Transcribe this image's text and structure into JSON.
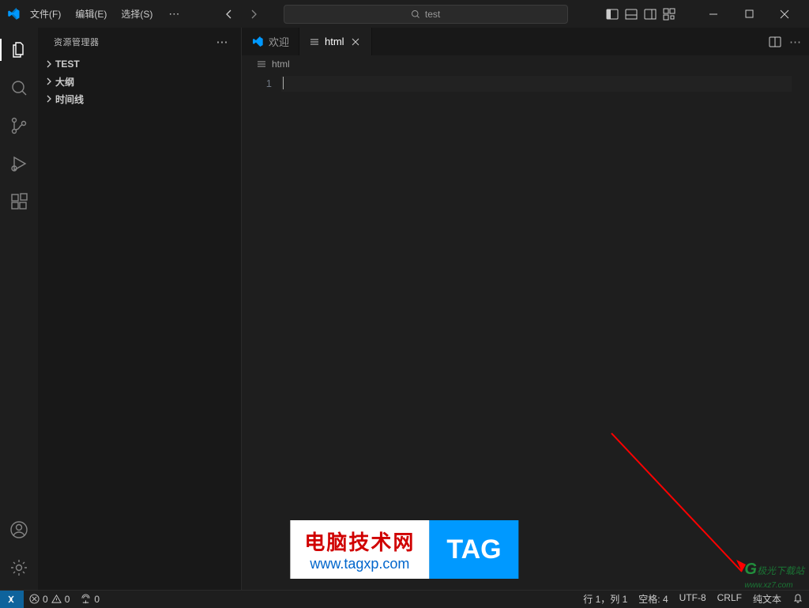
{
  "menubar": {
    "file": "文件(F)",
    "edit": "编辑(E)",
    "select": "选择(S)"
  },
  "search": {
    "value": "test"
  },
  "sidebar": {
    "title": "资源管理器",
    "sections": [
      {
        "label": "TEST"
      },
      {
        "label": "大纲"
      },
      {
        "label": "时间线"
      }
    ]
  },
  "tabs": {
    "welcome": "欢迎",
    "active": "html"
  },
  "breadcrumb": {
    "file": "html"
  },
  "editor": {
    "line_number": "1"
  },
  "statusbar": {
    "errors": "0",
    "warnings": "0",
    "ports": "0",
    "cursor": "行 1，列 1",
    "spaces": "空格: 4",
    "encoding": "UTF-8",
    "eol": "CRLF",
    "language": "纯文本"
  },
  "watermark": {
    "title": "电脑技术网",
    "url": "www.tagxp.com",
    "tag": "TAG",
    "site2a": "极光下载站",
    "site2b": "www.xz7.com"
  }
}
